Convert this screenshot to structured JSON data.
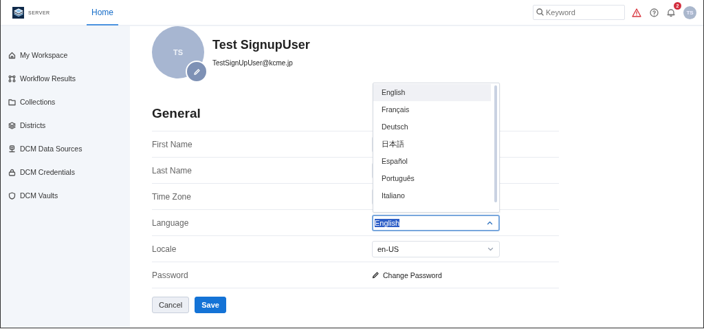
{
  "header": {
    "logo_text": "SERVER",
    "tabs": [
      {
        "label": "Home",
        "selected": true
      }
    ],
    "search": {
      "placeholder": "Keyword"
    },
    "notification_count": "2",
    "avatar_initials": "TS"
  },
  "sidebar": {
    "items": [
      {
        "label": "My Workspace"
      },
      {
        "label": "Workflow Results"
      },
      {
        "label": "Collections"
      },
      {
        "label": "Districts"
      },
      {
        "label": "DCM Data Sources"
      },
      {
        "label": "DCM Credentials"
      },
      {
        "label": "DCM Vaults"
      }
    ]
  },
  "profile": {
    "initials": "TS",
    "name": "Test SignupUser",
    "email": "TestSignUpUser@kcme.jp"
  },
  "section_title": "General",
  "fields": [
    {
      "label": "First Name",
      "kind": "text"
    },
    {
      "label": "Last Name",
      "kind": "text"
    },
    {
      "label": "Time Zone",
      "kind": "select"
    },
    {
      "label": "Language",
      "kind": "select",
      "value": "English",
      "expanded": true,
      "options": [
        {
          "label": "English",
          "selected": true
        },
        {
          "label": "Français",
          "selected": false
        },
        {
          "label": "Deutsch",
          "selected": false
        },
        {
          "label": "日本語",
          "selected": false
        },
        {
          "label": "Español",
          "selected": false
        },
        {
          "label": "Português",
          "selected": false
        },
        {
          "label": "Italiano",
          "selected": false
        }
      ]
    },
    {
      "label": "Locale",
      "kind": "select",
      "value": "en-US",
      "expanded": false
    },
    {
      "label": "Password",
      "kind": "link",
      "link": "Change Password"
    }
  ],
  "buttons": [
    {
      "label": "Cancel",
      "kind": "secondary"
    },
    {
      "label": "Save",
      "kind": "primary"
    }
  ]
}
